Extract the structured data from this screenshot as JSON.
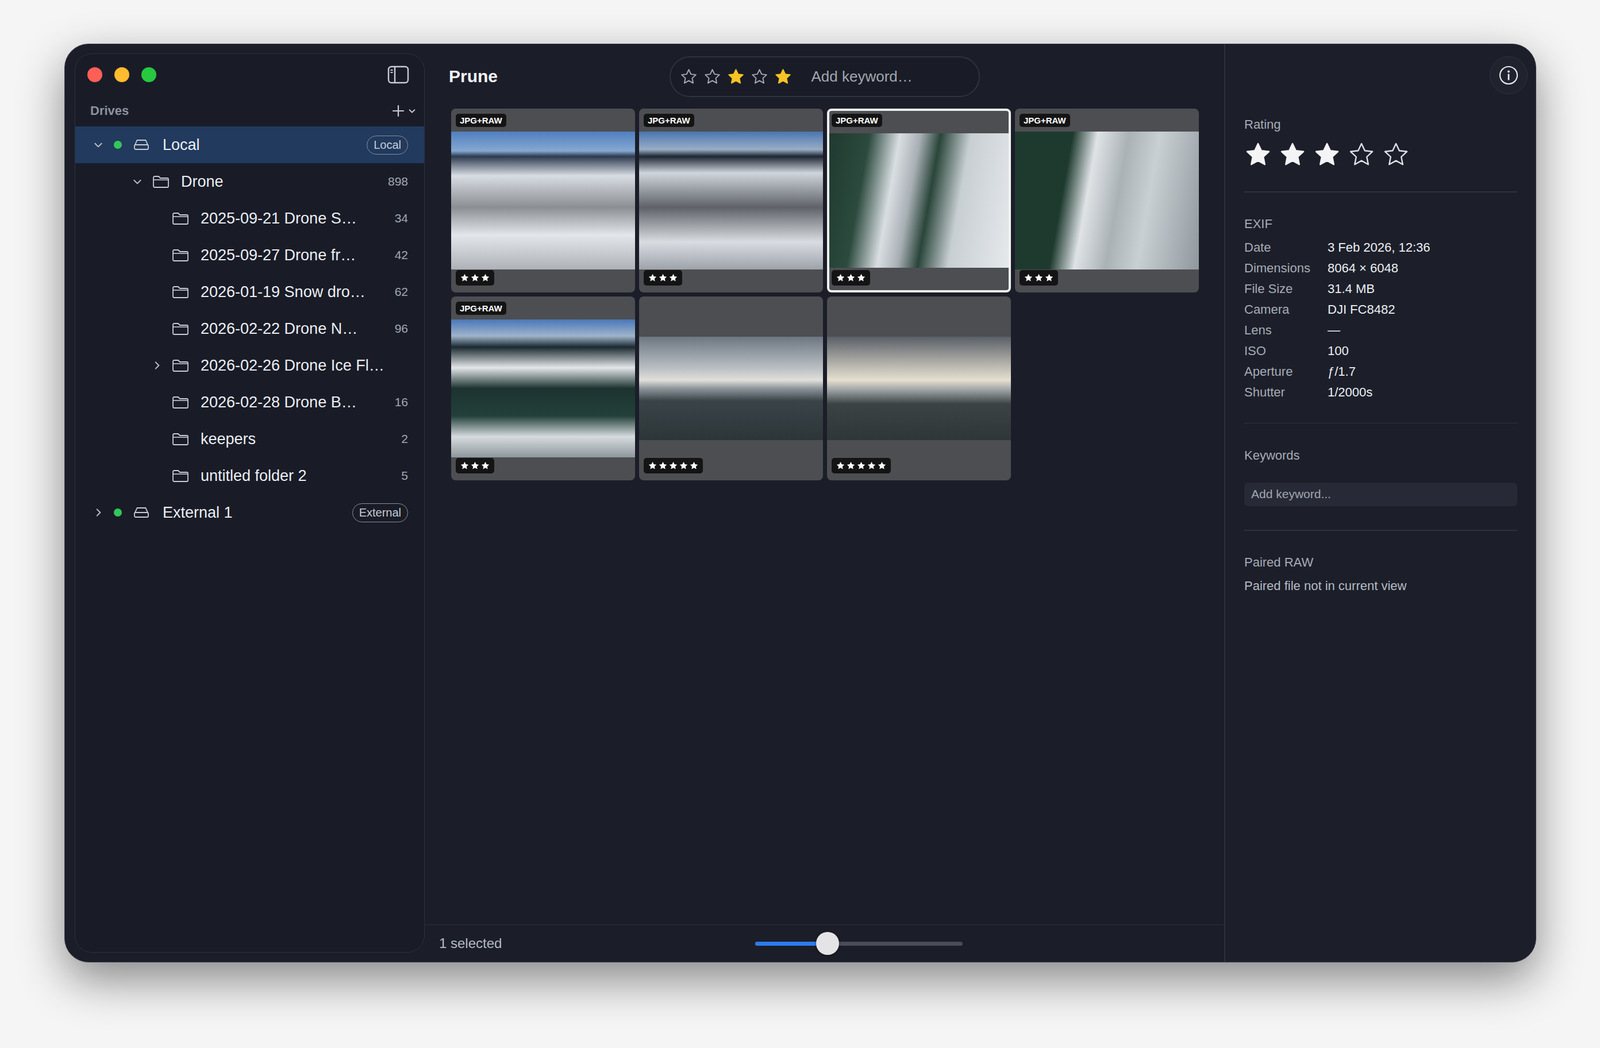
{
  "sidebar": {
    "section_label": "Drives",
    "items": [
      {
        "kind": "drive",
        "label": "Local",
        "depth": 0,
        "expandable": true,
        "expanded": true,
        "selected": true,
        "online": true,
        "badge": "Local"
      },
      {
        "kind": "folder",
        "label": "Drone",
        "depth": 1,
        "expandable": true,
        "expanded": true,
        "selected": false,
        "count": "898"
      },
      {
        "kind": "folder",
        "label": "2025-09-21 Drone S…",
        "depth": 2,
        "expandable": false,
        "expanded": false,
        "selected": false,
        "count": "34"
      },
      {
        "kind": "folder",
        "label": "2025-09-27 Drone fr…",
        "depth": 2,
        "expandable": false,
        "expanded": false,
        "selected": false,
        "count": "42"
      },
      {
        "kind": "folder",
        "label": "2026-01-19 Snow dro…",
        "depth": 2,
        "expandable": false,
        "expanded": false,
        "selected": false,
        "count": "62"
      },
      {
        "kind": "folder",
        "label": "2026-02-22 Drone N…",
        "depth": 2,
        "expandable": false,
        "expanded": false,
        "selected": false,
        "count": "96"
      },
      {
        "kind": "folder",
        "label": "2026-02-26 Drone Ice Fl…",
        "depth": 2,
        "expandable": true,
        "expanded": false,
        "selected": false
      },
      {
        "kind": "folder",
        "label": "2026-02-28 Drone B…",
        "depth": 2,
        "expandable": false,
        "expanded": false,
        "selected": false,
        "count": "16"
      },
      {
        "kind": "folder",
        "label": "keepers",
        "depth": 2,
        "expandable": false,
        "expanded": false,
        "selected": false,
        "count": "2"
      },
      {
        "kind": "folder",
        "label": "untitled folder 2",
        "depth": 2,
        "expandable": false,
        "expanded": false,
        "selected": false,
        "count": "5"
      },
      {
        "kind": "drive",
        "label": "External 1",
        "depth": 0,
        "expandable": true,
        "expanded": false,
        "selected": false,
        "online": true,
        "badge": "External"
      }
    ]
  },
  "header": {
    "title": "Prune",
    "filter_stars": [
      {
        "on": false
      },
      {
        "on": false
      },
      {
        "on": true
      },
      {
        "on": false
      },
      {
        "on": true
      }
    ],
    "keyword_placeholder": "Add keyword…"
  },
  "grid": {
    "tiles": [
      {
        "kind": "pair",
        "badge": "JPG+RAW",
        "stars": 3,
        "selected": false
      },
      {
        "kind": "pair",
        "badge": "JPG+RAW",
        "stars": 3,
        "selected": false
      },
      {
        "kind": "pair",
        "badge": "JPG+RAW",
        "stars": 3,
        "selected": true
      },
      {
        "kind": "pair",
        "badge": "JPG+RAW",
        "stars": 3,
        "selected": false
      },
      {
        "kind": "pair",
        "badge": "JPG+RAW",
        "stars": 3,
        "selected": false
      },
      {
        "kind": "single",
        "stars": 5,
        "selected": false
      },
      {
        "kind": "single",
        "stars": 5,
        "selected": false
      }
    ]
  },
  "status_bar": {
    "text": "1 selected",
    "zoom": {
      "level": 0.35
    }
  },
  "inspector": {
    "rating": {
      "label": "Rating",
      "stars": 3,
      "max": 5
    },
    "exif": {
      "label": "EXIF",
      "rows": [
        {
          "label": "Date",
          "value": "3 Feb 2026, 12:36"
        },
        {
          "label": "Dimensions",
          "value": "8064 × 6048"
        },
        {
          "label": "File Size",
          "value": "31.4 MB"
        },
        {
          "label": "Camera",
          "value": "DJI FC8482"
        },
        {
          "label": "Lens",
          "value": "—"
        },
        {
          "label": "ISO",
          "value": "100"
        },
        {
          "label": "Aperture",
          "value": "ƒ/1.7"
        },
        {
          "label": "Shutter",
          "value": "1/2000s"
        }
      ]
    },
    "keywords": {
      "label": "Keywords",
      "placeholder": "Add keyword..."
    },
    "paired_raw": {
      "label": "Paired RAW",
      "text": "Paired file not in current view"
    }
  }
}
